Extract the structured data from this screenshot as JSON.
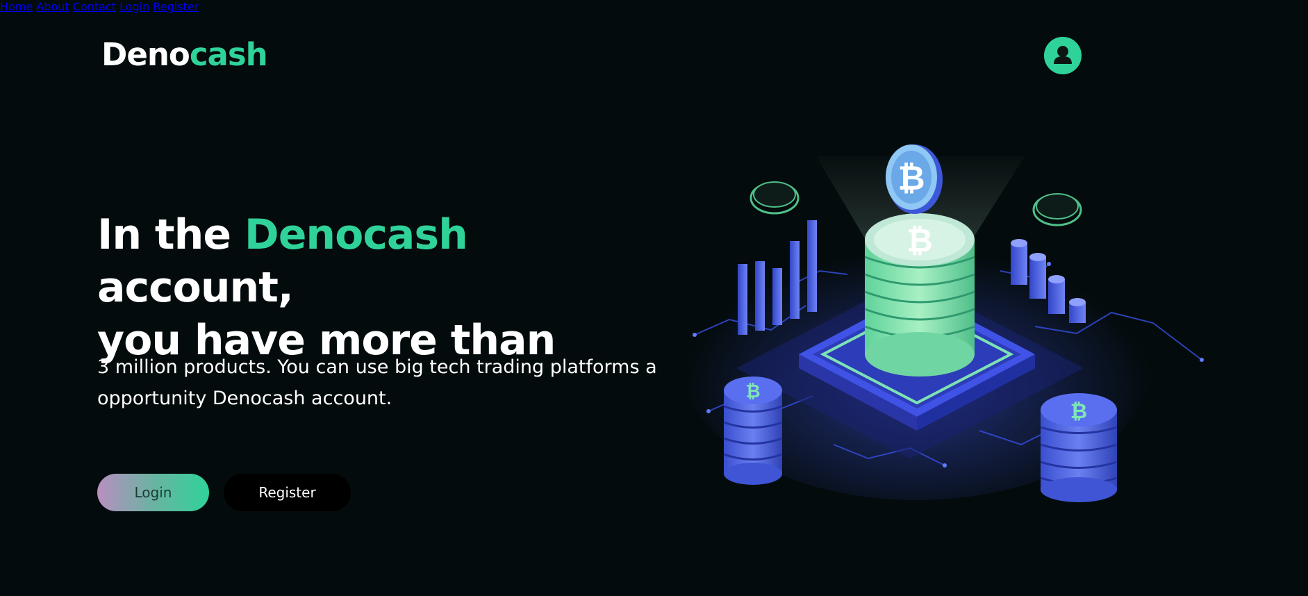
{
  "brand": {
    "logo_part1": "Deno",
    "logo_part2": "cash",
    "accent_color": "#2fd39a",
    "background_color": "#040b0c"
  },
  "nav": {
    "home": "Home",
    "about": "About",
    "contact": "Contact",
    "user_icon": "user-icon",
    "login": "Login",
    "register": "Register"
  },
  "hero": {
    "title_part1": "In the ",
    "title_accent": "Denocash",
    "title_part2": " account,",
    "title_line2": "you have more than",
    "subtitle_line1": "3 million products. You can use big tech trading platforms a",
    "subtitle_line2": "opportunity Denocash account.",
    "login_button": "Login",
    "register_button": "Register"
  },
  "illustration": {
    "coin_symbol": "₿"
  }
}
